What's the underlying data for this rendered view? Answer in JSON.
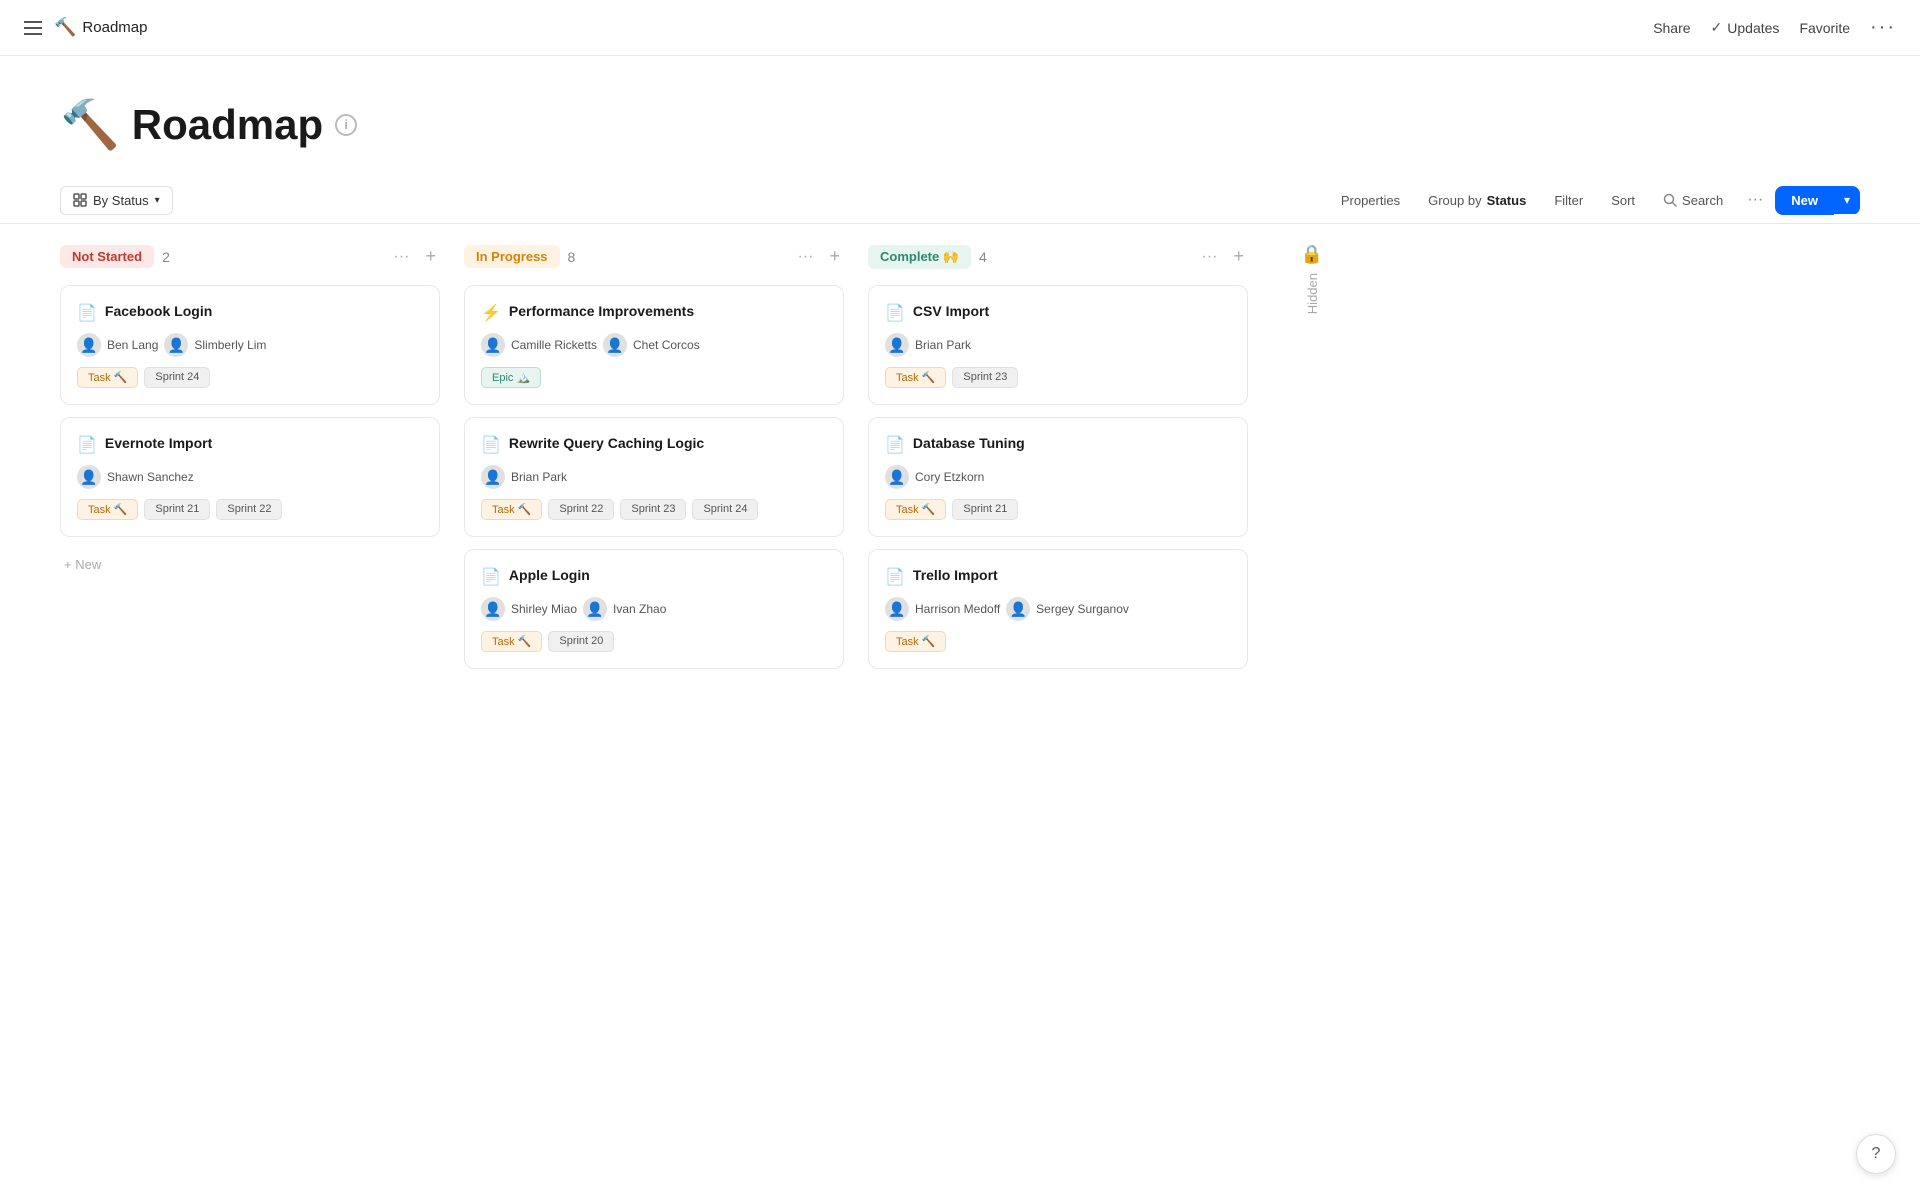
{
  "nav": {
    "title": "Roadmap",
    "icon": "🔨",
    "share": "Share",
    "updates": "Updates",
    "favorite": "Favorite"
  },
  "page": {
    "emoji": "🔨",
    "title": "Roadmap",
    "info_icon": "i"
  },
  "toolbar": {
    "view_label": "By Status",
    "properties": "Properties",
    "group_by": "Group by",
    "group_by_bold": "Status",
    "filter": "Filter",
    "sort": "Sort",
    "search": "Search",
    "new_label": "New",
    "more_dots": "···"
  },
  "columns": [
    {
      "id": "not-started",
      "status_label": "Not Started",
      "status_class": "not-started",
      "count": 2,
      "cards": [
        {
          "icon": "📄",
          "title": "Facebook Login",
          "members": [
            {
              "name": "Ben Lang",
              "avatar": "👤"
            },
            {
              "name": "Slimberly Lim",
              "avatar": "👤"
            }
          ],
          "tags": [
            {
              "label": "Task 🔨",
              "type": "task"
            },
            {
              "label": "Sprint 24",
              "type": "sprint"
            }
          ]
        },
        {
          "icon": "📄",
          "title": "Evernote Import",
          "members": [
            {
              "name": "Shawn Sanchez",
              "avatar": "👤"
            }
          ],
          "tags": [
            {
              "label": "Task 🔨",
              "type": "task"
            },
            {
              "label": "Sprint 21",
              "type": "sprint"
            },
            {
              "label": "Sprint 22",
              "type": "sprint"
            }
          ]
        }
      ]
    },
    {
      "id": "in-progress",
      "status_label": "In Progress",
      "status_class": "in-progress",
      "count": 8,
      "cards": [
        {
          "icon": "⚡",
          "title": "Performance Improvements",
          "members": [
            {
              "name": "Camille Ricketts",
              "avatar": "👤"
            },
            {
              "name": "Chet Corcos",
              "avatar": "👤"
            }
          ],
          "tags": [
            {
              "label": "Epic 🏔️",
              "type": "epic"
            }
          ]
        },
        {
          "icon": "📄",
          "title": "Rewrite Query Caching Logic",
          "members": [
            {
              "name": "Brian Park",
              "avatar": "👤"
            }
          ],
          "tags": [
            {
              "label": "Task 🔨",
              "type": "task"
            },
            {
              "label": "Sprint 22",
              "type": "sprint"
            },
            {
              "label": "Sprint 23",
              "type": "sprint"
            },
            {
              "label": "Sprint 24",
              "type": "sprint"
            }
          ]
        },
        {
          "icon": "📄",
          "title": "Apple Login",
          "members": [
            {
              "name": "Shirley Miao",
              "avatar": "👤"
            },
            {
              "name": "Ivan Zhao",
              "avatar": "👤"
            }
          ],
          "tags": [
            {
              "label": "Task 🔨",
              "type": "task"
            },
            {
              "label": "Sprint 20",
              "type": "sprint"
            }
          ]
        }
      ]
    },
    {
      "id": "complete",
      "status_label": "Complete 🙌",
      "status_class": "complete",
      "count": 4,
      "cards": [
        {
          "icon": "📄",
          "title": "CSV Import",
          "members": [
            {
              "name": "Brian Park",
              "avatar": "👤"
            }
          ],
          "tags": [
            {
              "label": "Task 🔨",
              "type": "task"
            },
            {
              "label": "Sprint 23",
              "type": "sprint"
            }
          ]
        },
        {
          "icon": "📄",
          "title": "Database Tuning",
          "members": [
            {
              "name": "Cory Etzkorn",
              "avatar": "👤"
            }
          ],
          "tags": [
            {
              "label": "Task 🔨",
              "type": "task"
            },
            {
              "label": "Sprint 21",
              "type": "sprint"
            }
          ]
        },
        {
          "icon": "📄",
          "title": "Trello Import",
          "members": [
            {
              "name": "Harrison Medoff",
              "avatar": "👤"
            },
            {
              "name": "Sergey Surganov",
              "avatar": "👤"
            }
          ],
          "tags": [
            {
              "label": "Task 🔨",
              "type": "task"
            }
          ]
        }
      ]
    }
  ],
  "add_new": "+ New",
  "hidden_col": "Hidden",
  "help_icon": "?"
}
